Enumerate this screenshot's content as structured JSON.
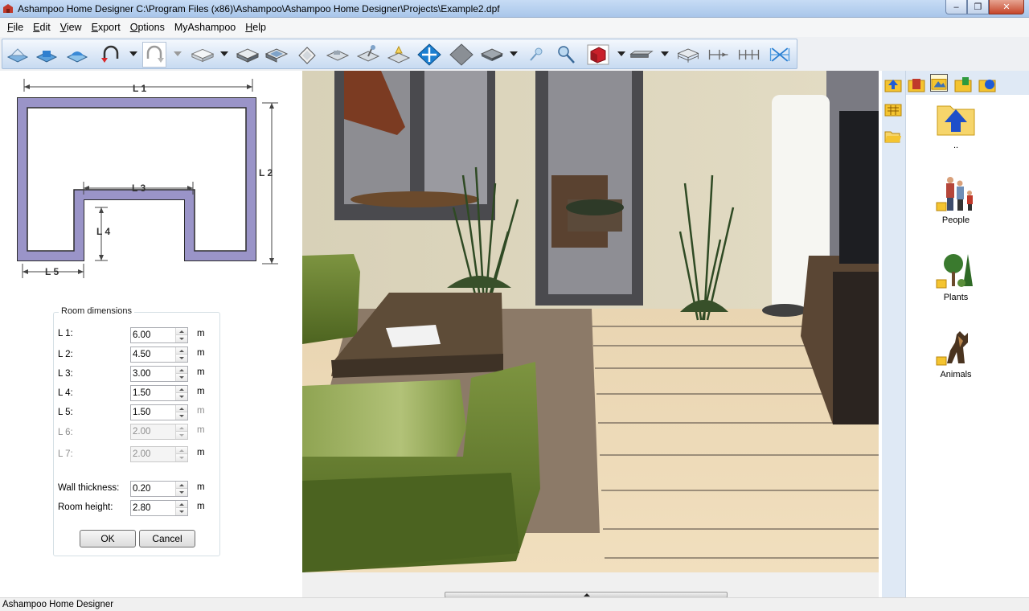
{
  "window": {
    "title": "Ashampoo Home Designer C:\\Program Files (x86)\\Ashampoo\\Ashampoo Home Designer\\Projects\\Example2.dpf",
    "minimize": "–",
    "maximize": "❐",
    "close": "✕"
  },
  "menu": [
    {
      "accel": "F",
      "rest": "ile"
    },
    {
      "accel": "E",
      "rest": "dit"
    },
    {
      "accel": "V",
      "rest": "iew"
    },
    {
      "accel": "E",
      "rest": "xport"
    },
    {
      "accel": "O",
      "rest": "ptions"
    },
    {
      "accel": "",
      "rest": "MyAshampoo"
    },
    {
      "accel": "H",
      "rest": "elp"
    }
  ],
  "diagram": {
    "l1": "L 1",
    "l2": "L 2",
    "l3": "L 3",
    "l4": "L 4",
    "l5": "L 5",
    "wall_color": "#9a94c8"
  },
  "room_dimensions": {
    "title": "Room dimensions",
    "unit": "m",
    "rows": [
      {
        "label": "L 1:",
        "value": "6.00",
        "enabled": true
      },
      {
        "label": "L 2:",
        "value": "4.50",
        "enabled": true
      },
      {
        "label": "L 3:",
        "value": "3.00",
        "enabled": true
      },
      {
        "label": "L 4:",
        "value": "1.50",
        "enabled": true
      },
      {
        "label": "L 5:",
        "value": "1.50",
        "enabled": true
      },
      {
        "label": "L 6:",
        "value": "2.00",
        "enabled": false
      },
      {
        "label": "L 7:",
        "value": "2.00",
        "enabled": false
      }
    ],
    "wall_thickness": {
      "label": "Wall thickness:",
      "value": "0.20"
    },
    "room_height": {
      "label": "Room height:",
      "value": "2.80"
    },
    "ok": "OK",
    "cancel": "Cancel"
  },
  "library": {
    "up_label": "..",
    "items": [
      {
        "label": "People"
      },
      {
        "label": "Plants"
      },
      {
        "label": "Animals"
      }
    ]
  },
  "status": {
    "text": "Ashampoo Home Designer"
  }
}
